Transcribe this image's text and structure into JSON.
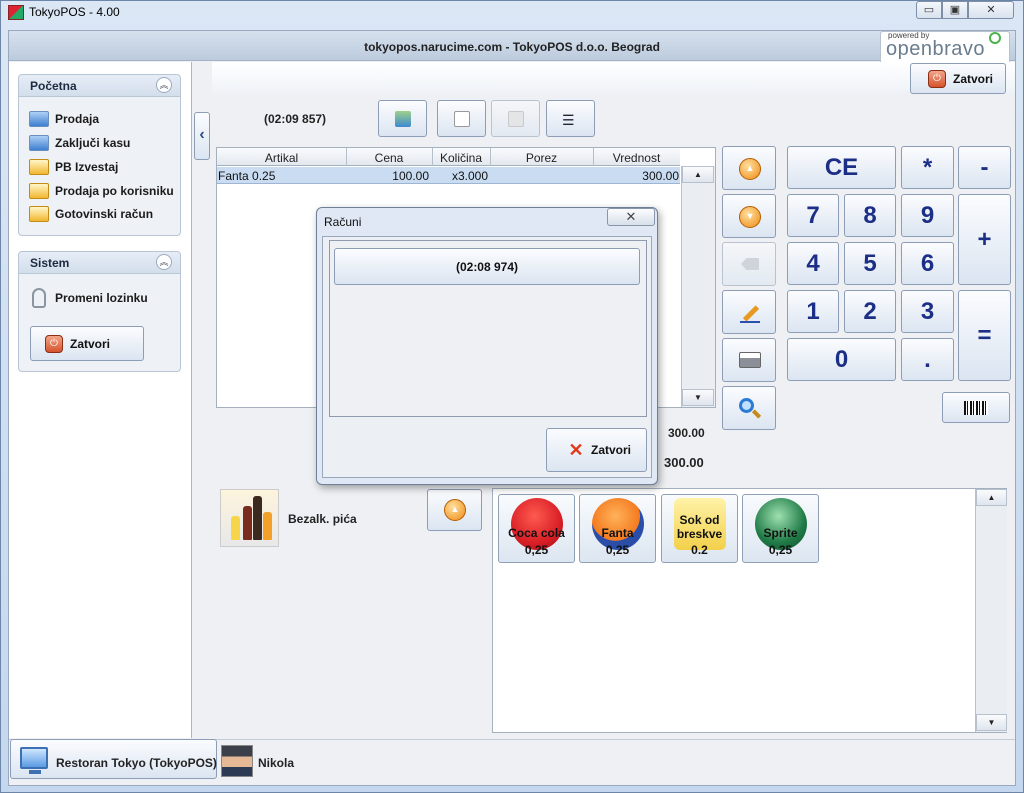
{
  "window": {
    "title": "TokyoPOS - 4.00",
    "minimize": "▭",
    "maximize": "▣",
    "close": "✕"
  },
  "header": {
    "title": "tokyopos.narucime.com - TokyoPOS d.o.o. Beograd",
    "logo_small": "powered by",
    "logo_main": "openbravo",
    "close_label": "Zatvori"
  },
  "sidebar": {
    "pocetna": {
      "title": "Početna",
      "collapse": "︽",
      "items": [
        {
          "label": "Prodaja",
          "icon": "monitor-icon"
        },
        {
          "label": "Zaključi kasu",
          "icon": "monitor-icon"
        },
        {
          "label": "PB Izvestaj",
          "icon": "report-icon"
        },
        {
          "label": "Prodaja po korisniku",
          "icon": "report-icon"
        },
        {
          "label": "Gotovinski račun",
          "icon": "report-icon"
        }
      ]
    },
    "sistem": {
      "title": "Sistem",
      "collapse": "︽",
      "change_password": "Promeni lozinku",
      "close_label": "Zatvori"
    },
    "toggle": "‹"
  },
  "ticket": {
    "id": "(02:09 857)",
    "columns": [
      "Artikal",
      "Cena",
      "Količina",
      "Porez",
      "Vrednost"
    ],
    "rows": [
      {
        "artikal": "Fanta 0.25",
        "cena": "100.00",
        "kolicina": "x3.000",
        "porez": "",
        "vrednost": "300.00"
      }
    ],
    "subtotal": "300.00",
    "total": "300.00",
    "scroll_up": "▲",
    "scroll_down": "▼"
  },
  "keypad": {
    "ce": "CE",
    "multiply": "*",
    "minus": "-",
    "plus": "+",
    "equals": "=",
    "k7": "7",
    "k8": "8",
    "k9": "9",
    "k4": "4",
    "k5": "5",
    "k6": "6",
    "k1": "1",
    "k2": "2",
    "k3": "3",
    "k0": "0",
    "dot": "."
  },
  "category": {
    "label": "Bezalk. pića"
  },
  "products": [
    {
      "name": "Coca cola",
      "price": "0,25",
      "color": "#d81f26"
    },
    {
      "name": "Fanta",
      "price": "0,25",
      "color": "#f47a1f"
    },
    {
      "name": "Sok od breskve",
      "price": "0.2",
      "color": "#f3d04a"
    },
    {
      "name": "Sprite",
      "price": "0,25",
      "color": "#1f7a46"
    }
  ],
  "products_scroll": {
    "up": "▲",
    "down": "▼"
  },
  "status": {
    "host": "Restoran Tokyo (TokyoPOS)",
    "user": "Nikola"
  },
  "dialog": {
    "title": "Računi",
    "close_x": "✕",
    "tickets": [
      "(02:08 974)"
    ],
    "close_label": "Zatvori"
  }
}
